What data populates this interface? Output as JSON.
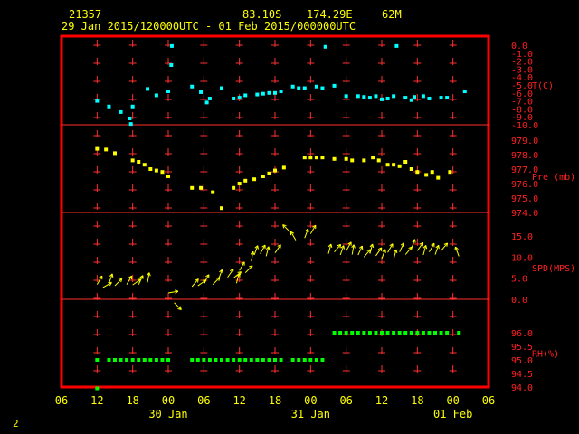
{
  "header": {
    "station_id": "21357",
    "latitude": "83.10S",
    "longitude": "174.29E",
    "elevation": "62M",
    "period": "29 Jan 2015/120000UTC - 01 Feb 2015/000000UTC"
  },
  "page_number": "2",
  "colors": {
    "frame": "#ff0000",
    "grid": "#ff3030",
    "labels": "#ff2020",
    "axis_text": "#ffff00",
    "temperature": "#00ffff",
    "pressure": "#ffff00",
    "wind": "#ffff00",
    "humidity": "#00ff00"
  },
  "chart_data": {
    "type": "scatter",
    "x_axis": {
      "unit": "hours since 29 Jan 00 UTC",
      "range": [
        6,
        78
      ],
      "tick_values": [
        6,
        12,
        18,
        24,
        30,
        36,
        42,
        48,
        54,
        60,
        66,
        72,
        78
      ],
      "tick_labels": [
        "06",
        "12",
        "18",
        "00",
        "06",
        "12",
        "18",
        "00",
        "06",
        "12",
        "18",
        "00",
        "06"
      ],
      "date_labels": [
        {
          "x": 24,
          "text": "30 Jan"
        },
        {
          "x": 48,
          "text": "31 Jan"
        },
        {
          "x": 72,
          "text": "01 Feb"
        }
      ],
      "vertical_gridlines": [
        12,
        18,
        24,
        30,
        36,
        42,
        48,
        54,
        60,
        66,
        72
      ]
    },
    "panels": [
      {
        "id": "temperature",
        "label": "T(C)",
        "ylim": [
          -10,
          0
        ],
        "tick_values": [
          0,
          -1,
          -2,
          -3,
          -4,
          -5,
          -6,
          -7,
          -8,
          -9,
          -10
        ],
        "tick_labels": [
          "0.0",
          "-1.0",
          "-2.0",
          "-3.0",
          "-4.0",
          "-5.0",
          "-6.0",
          "-7.0",
          "-8.0",
          "-9.0",
          "-10.0"
        ],
        "points": [
          [
            12,
            -7.0
          ],
          [
            14,
            -7.7
          ],
          [
            16,
            -8.4
          ],
          [
            17.5,
            -9.2
          ],
          [
            17.7,
            -9.9
          ],
          [
            18,
            -7.7
          ],
          [
            20.5,
            -5.5
          ],
          [
            22,
            -6.3
          ],
          [
            24,
            -5.8
          ],
          [
            24.5,
            -2.5
          ],
          [
            24.6,
            -0.1
          ],
          [
            28,
            -5.2
          ],
          [
            29.5,
            -5.9
          ],
          [
            30.5,
            -7.2
          ],
          [
            31,
            -6.7
          ],
          [
            33,
            -5.4
          ],
          [
            35,
            -6.7
          ],
          [
            36,
            -6.6
          ],
          [
            37,
            -6.3
          ],
          [
            39,
            -6.2
          ],
          [
            40,
            -6.1
          ],
          [
            41,
            -6.0
          ],
          [
            42,
            -6.0
          ],
          [
            43,
            -5.8
          ],
          [
            45,
            -5.2
          ],
          [
            46,
            -5.4
          ],
          [
            47,
            -5.4
          ],
          [
            49,
            -5.2
          ],
          [
            50,
            -5.4
          ],
          [
            50.5,
            -0.2
          ],
          [
            52,
            -5.1
          ],
          [
            54,
            -6.4
          ],
          [
            56,
            -6.4
          ],
          [
            57,
            -6.5
          ],
          [
            58,
            -6.6
          ],
          [
            59,
            -6.4
          ],
          [
            60,
            -6.8
          ],
          [
            61,
            -6.7
          ],
          [
            62,
            -6.4
          ],
          [
            62.5,
            -0.1
          ],
          [
            64,
            -6.6
          ],
          [
            65,
            -6.9
          ],
          [
            65.5,
            -6.5
          ],
          [
            67,
            -6.4
          ],
          [
            68,
            -6.7
          ],
          [
            70,
            -6.6
          ],
          [
            71,
            -6.6
          ],
          [
            74,
            -5.8
          ]
        ]
      },
      {
        "id": "pressure",
        "label": "Pre (mb)",
        "ylim": [
          974,
          979
        ],
        "tick_values": [
          979,
          978,
          977,
          976,
          975,
          974
        ],
        "tick_labels": [
          "979.0",
          "978.0",
          "977.0",
          "976.0",
          "975.0",
          "974.0"
        ],
        "points": [
          [
            12,
            978.4
          ],
          [
            13.5,
            978.35
          ],
          [
            15,
            978.1
          ],
          [
            18,
            977.6
          ],
          [
            19,
            977.5
          ],
          [
            20,
            977.3
          ],
          [
            21,
            977.0
          ],
          [
            22,
            976.9
          ],
          [
            23,
            976.8
          ],
          [
            24,
            976.5
          ],
          [
            28,
            975.7
          ],
          [
            29.5,
            975.7
          ],
          [
            31.5,
            975.4
          ],
          [
            33,
            974.3
          ],
          [
            35,
            975.7
          ],
          [
            36,
            976.0
          ],
          [
            37,
            976.2
          ],
          [
            38.5,
            976.3
          ],
          [
            40,
            976.5
          ],
          [
            41,
            976.7
          ],
          [
            42,
            976.9
          ],
          [
            43.5,
            977.1
          ],
          [
            47,
            977.8
          ],
          [
            48,
            977.8
          ],
          [
            49,
            977.8
          ],
          [
            50,
            977.8
          ],
          [
            52,
            977.7
          ],
          [
            54,
            977.7
          ],
          [
            55,
            977.6
          ],
          [
            57,
            977.6
          ],
          [
            58.5,
            977.8
          ],
          [
            59.5,
            977.6
          ],
          [
            61,
            977.3
          ],
          [
            62,
            977.3
          ],
          [
            63,
            977.2
          ],
          [
            64,
            977.5
          ],
          [
            65,
            977.0
          ],
          [
            66,
            976.8
          ],
          [
            67.5,
            976.6
          ],
          [
            68.5,
            976.8
          ],
          [
            69.5,
            976.4
          ],
          [
            71.5,
            976.8
          ]
        ]
      },
      {
        "id": "wind_speed",
        "label": "SPD(MPS)",
        "ylim": [
          0,
          15
        ],
        "tick_values": [
          15,
          10,
          5,
          0
        ],
        "tick_labels": [
          "15.0",
          "10.0",
          "5.0",
          "0.0"
        ],
        "wind_barbs": [
          [
            12,
            3.5,
            30
          ],
          [
            13,
            2.8,
            60
          ],
          [
            14,
            3.8,
            20
          ],
          [
            15,
            3.2,
            45
          ],
          [
            17,
            3.5,
            30
          ],
          [
            18,
            3.4,
            55
          ],
          [
            19,
            3.5,
            25
          ],
          [
            20.5,
            4.0,
            10
          ],
          [
            24,
            1.5,
            80
          ],
          [
            25,
            -0.8,
            135
          ],
          [
            28,
            3.0,
            40
          ],
          [
            29,
            3.2,
            55
          ],
          [
            30,
            3.8,
            30
          ],
          [
            31.5,
            3.5,
            45
          ],
          [
            32.5,
            4.8,
            20
          ],
          [
            34,
            5.2,
            35
          ],
          [
            35,
            5.0,
            50
          ],
          [
            35.5,
            3.8,
            15
          ],
          [
            36,
            6.8,
            30
          ],
          [
            37,
            6.3,
            45
          ],
          [
            38,
            9.0,
            10
          ],
          [
            38.5,
            10.5,
            20
          ],
          [
            39.5,
            10.8,
            30
          ],
          [
            40.5,
            10.2,
            15
          ],
          [
            42,
            11.0,
            35
          ],
          [
            44.5,
            16.0,
            -45
          ],
          [
            45.5,
            14.0,
            -30
          ],
          [
            47,
            14.5,
            20
          ],
          [
            48,
            15.5,
            30
          ],
          [
            51,
            10.8,
            15
          ],
          [
            52,
            11.2,
            40
          ],
          [
            53,
            10.5,
            20
          ],
          [
            54,
            11.5,
            30
          ],
          [
            55,
            10.6,
            10
          ],
          [
            56,
            10.5,
            25
          ],
          [
            57,
            10.0,
            40
          ],
          [
            58,
            10.8,
            15
          ],
          [
            59,
            10.3,
            35
          ],
          [
            60,
            9.6,
            20
          ],
          [
            61,
            11.1,
            30
          ],
          [
            62,
            9.5,
            15
          ],
          [
            63,
            11.2,
            25
          ],
          [
            64,
            10.6,
            40
          ],
          [
            65,
            12.0,
            20
          ],
          [
            66,
            11.5,
            35
          ],
          [
            67,
            10.5,
            15
          ],
          [
            68,
            11.2,
            30
          ],
          [
            69,
            10.6,
            20
          ],
          [
            70,
            11.5,
            40
          ],
          [
            73,
            10.2,
            -20
          ]
        ]
      },
      {
        "id": "humidity",
        "label": "RH(%)",
        "ylim": [
          94,
          96.5
        ],
        "tick_values": [
          96,
          95.5,
          95,
          94.5,
          94
        ],
        "tick_labels": [
          "96.0",
          "95.5",
          "95.0",
          "94.5",
          "94.0"
        ],
        "segments": [
          {
            "value": 95.0,
            "x": [
              12,
              14,
              15,
              16,
              17,
              18,
              19,
              20,
              21,
              22,
              23,
              24,
              28,
              29,
              30,
              31,
              32,
              33,
              34,
              35,
              36,
              37,
              38,
              39,
              40,
              41,
              42,
              43,
              45,
              46,
              47,
              48,
              49,
              50
            ]
          },
          {
            "value": 96.0,
            "x": [
              52,
              53,
              54,
              55,
              56,
              57,
              58,
              59,
              60,
              61,
              62,
              63,
              64,
              65,
              66,
              67,
              68,
              69,
              70,
              71,
              73
            ]
          }
        ],
        "extra_points": [
          [
            12,
            93.95
          ]
        ]
      }
    ]
  }
}
